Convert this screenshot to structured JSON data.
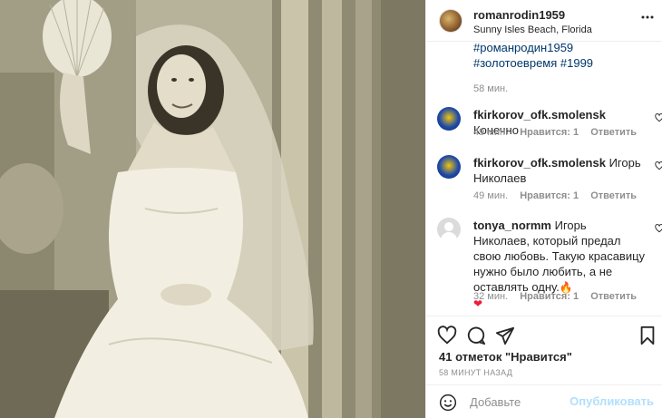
{
  "post": {
    "username": "romanrodin1959",
    "location": "Sunny Isles Beach, Florida",
    "caption_hashtags": "#романродин1959 #золотоевремя #1999",
    "caption_time": "58 мин."
  },
  "comments": [
    {
      "username": "fkirkorov_ofk.smolensk",
      "text": "Конечно",
      "time": "49 мин.",
      "likes": "Нравится: 1",
      "reply": "Ответить"
    },
    {
      "username": "fkirkorov_ofk.smolensk",
      "text": "Игорь Николаев",
      "time": "49 мин.",
      "likes": "Нравится: 1",
      "reply": "Ответить"
    },
    {
      "username": "tonya_normm",
      "text": "Игорь Николаев, который предал свою любовь. Такую красавицу нужно было любить, а не оставлять одну.",
      "emoji_fire": "🔥",
      "emoji_heart": "❤",
      "time": "32 мин.",
      "likes": "Нравится: 1",
      "reply": "Ответить"
    }
  ],
  "actions": {
    "like_icon": "heart-outline-icon",
    "comment_icon": "comment-bubble-icon",
    "share_icon": "paper-plane-icon",
    "save_icon": "bookmark-icon"
  },
  "likes_count": "41 отметок \"Нравится\"",
  "posted_ago": "58 МИНУТ НАЗАД",
  "add_comment": {
    "placeholder": "Добавьте",
    "publish_label": "Опубликовать"
  },
  "colors": {
    "link": "#00376b",
    "muted": "#8e8e8e",
    "publish_disabled": "#b2dffc"
  }
}
